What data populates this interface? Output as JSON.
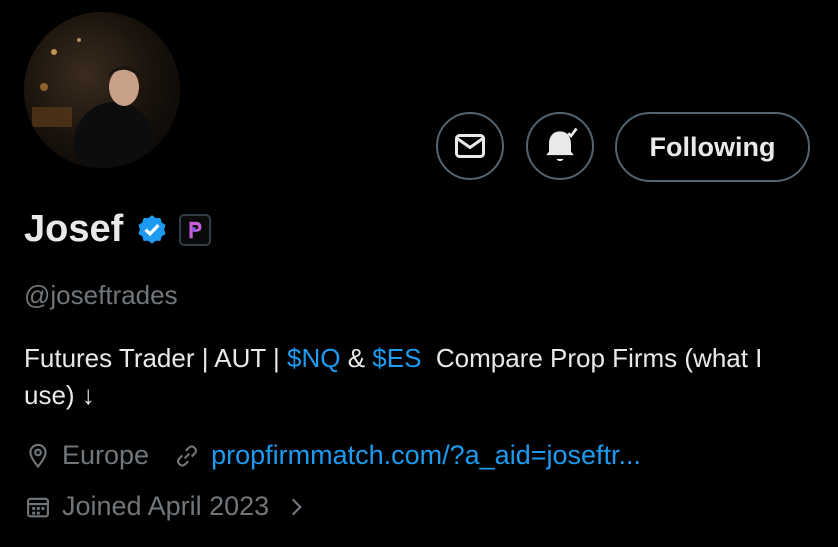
{
  "profile": {
    "display_name": "Josef",
    "handle": "@joseftrades",
    "bio": {
      "part1": "Futures Trader | AUT | ",
      "cashtag1": "$NQ",
      "amp": " & ",
      "cashtag2": "$ES",
      "part2": "  Compare Prop Firms (what I use) ↓"
    },
    "location": "Europe",
    "website": "propfirmmatch.com/?a_aid=joseftr...",
    "joined": "Joined April 2023"
  },
  "actions": {
    "following_label": "Following"
  },
  "icons": {
    "message": "mail-icon",
    "notifications": "bell-check-icon",
    "verified": "verified-badge-icon",
    "affiliate": "affiliate-logo-icon",
    "location": "location-pin-icon",
    "link": "link-icon",
    "calendar": "calendar-icon",
    "chevron": "chevron-right-icon"
  },
  "colors": {
    "background": "#000000",
    "text": "#e7e9ea",
    "secondary": "#71767b",
    "accent": "#1d9bf0",
    "border": "#536471"
  }
}
